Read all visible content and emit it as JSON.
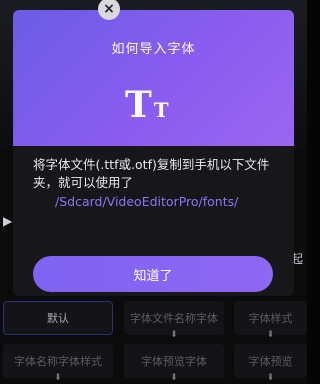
{
  "background": {
    "play_glyph": "▶",
    "right_text": "起",
    "chips": [
      {
        "label": "默认"
      },
      {
        "label": "字体文件名称字体",
        "sub": "⬇"
      },
      {
        "label": "字体样式",
        "sub": "⬇"
      },
      {
        "label": "字体名称字体样式",
        "sub": "⬇"
      },
      {
        "label": "字体预览字体",
        "sub": "⬇"
      },
      {
        "label": "字体预览",
        "sub": "⬇"
      }
    ]
  },
  "dialog": {
    "title": "如何导入字体",
    "icon_big": "T",
    "icon_small": "T",
    "body_text": "将字体文件(.ttf或.otf)复制到手机以下文件夹，就可以使用了",
    "path_text": "/Sdcard/VideoEditorPro/fonts/",
    "ok_label": "知道了",
    "close_glyph": "×"
  },
  "colors": {
    "header_gradient_start": "#6a5ce6",
    "header_gradient_end": "#9a66f0",
    "accent": "#8f73f6",
    "button": "#8566f3"
  }
}
